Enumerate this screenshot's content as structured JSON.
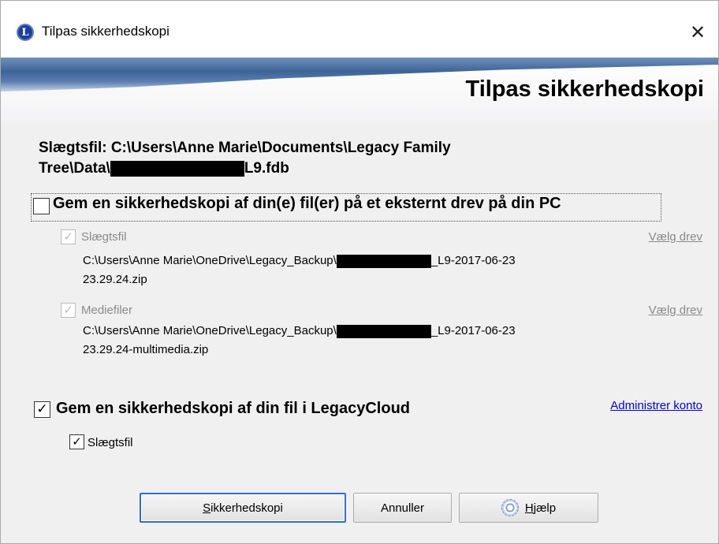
{
  "window": {
    "title": "Tilpas sikkerhedskopi",
    "close_glyph": "✕",
    "app_icon_letter": "L"
  },
  "banner": {
    "title": "Tilpas sikkerhedskopi"
  },
  "family_file": {
    "line1": "Slægtsfil: C:\\Users\\Anne Marie\\Documents\\Legacy Family",
    "line2_prefix": "Tree\\Data\\",
    "line2_suffix": "L9.fdb"
  },
  "external_backup": {
    "label": "Gem en sikkerhedskopi af din(e) fil(er) på et eksternt drev på din PC",
    "checked": false,
    "family_file": {
      "label": "Slægtsfil",
      "checked": true,
      "path_prefix": "C:\\Users\\Anne Marie\\OneDrive\\Legacy_Backup\\",
      "path_suffix": "_L9-2017-06-23",
      "path_line2": "23.29.24.zip",
      "choose_drive": "Vælg drev"
    },
    "media_files": {
      "label": "Mediefiler",
      "checked": true,
      "path_prefix": "C:\\Users\\Anne Marie\\OneDrive\\Legacy_Backup\\",
      "path_suffix": "_L9-2017-06-23",
      "path_line2": "23.29.24-multimedia.zip",
      "choose_drive": "Vælg drev"
    }
  },
  "cloud_backup": {
    "label": "Gem en sikkerhedskopi af din fil i LegacyCloud",
    "checked": true,
    "manage_account": "Administrer konto",
    "family_file_label": "Slægtsfil",
    "family_file_checked": true
  },
  "buttons": {
    "backup_first": "S",
    "backup_rest": "ikkerhedskopi",
    "cancel": "Annuller",
    "help_first": "H",
    "help_rest": "jælp"
  },
  "colors": {
    "link": "#0000ee",
    "disabled_text": "#8a8a8a",
    "banner_blue": "#3d6497"
  },
  "icons": {
    "app": "legacy-logo-icon",
    "help": "help-lifebuoy-icon",
    "close": "close-icon"
  }
}
